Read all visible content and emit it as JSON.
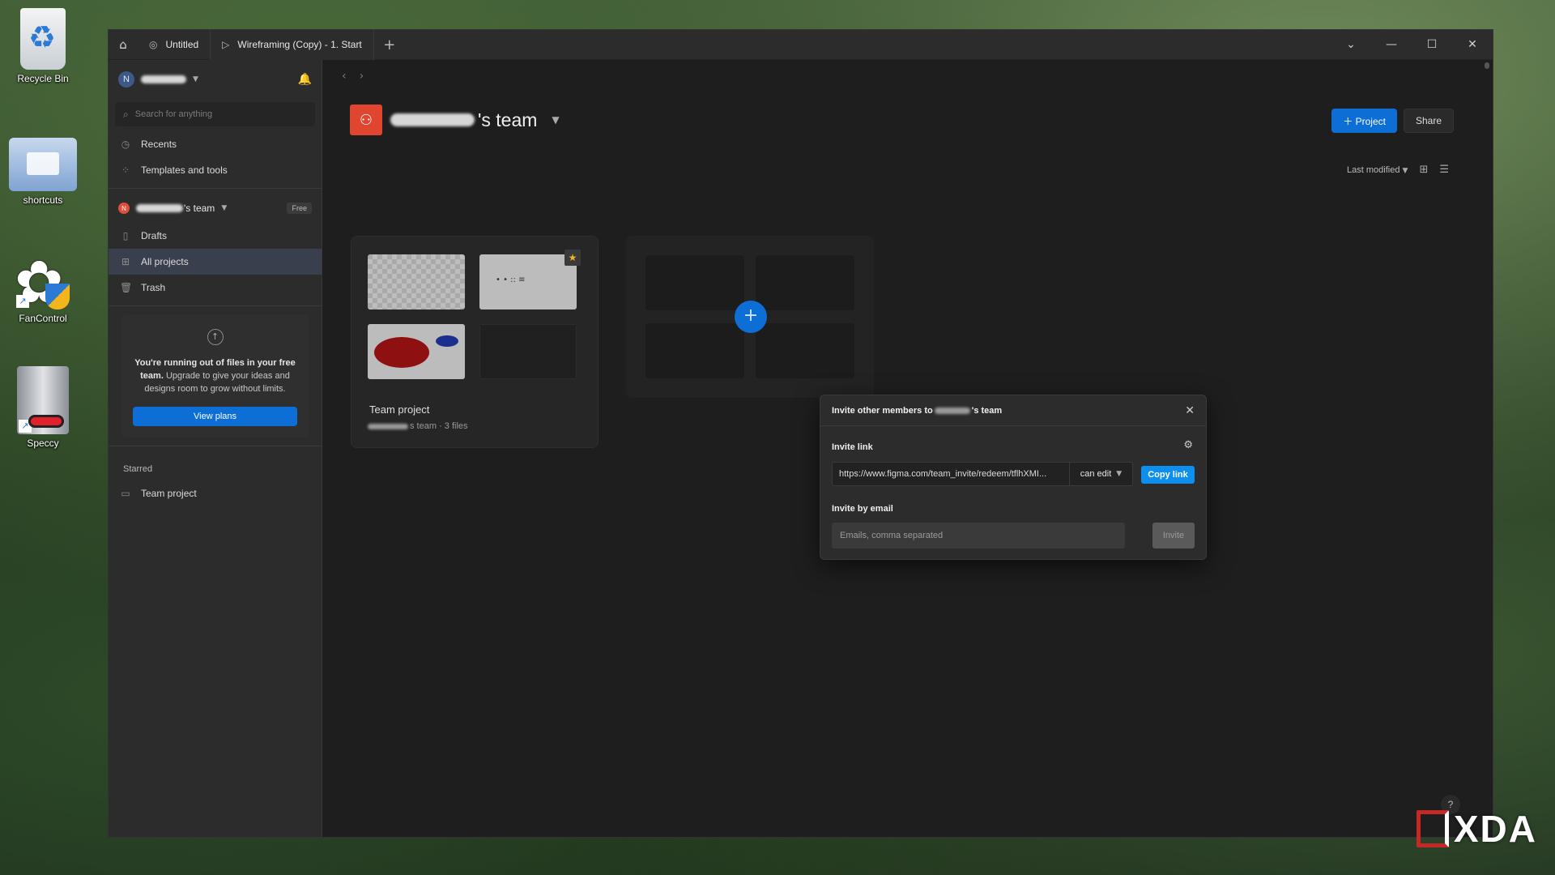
{
  "desktop": {
    "icons": [
      {
        "label": "Recycle Bin"
      },
      {
        "label": "shortcuts"
      },
      {
        "label": "FanControl"
      },
      {
        "label": "Speccy"
      }
    ]
  },
  "titlebar": {
    "tabs": [
      {
        "label": "Untitled"
      },
      {
        "label": "Wireframing (Copy) - 1. Start"
      }
    ]
  },
  "sidebar": {
    "avatar_initial": "N",
    "search_placeholder": "Search for anything",
    "nav": [
      {
        "label": "Recents"
      },
      {
        "label": "Templates and tools"
      }
    ],
    "team": {
      "initial": "N",
      "name_suffix": "'s team",
      "badge": "Free",
      "items": [
        {
          "label": "Drafts"
        },
        {
          "label": "All projects"
        },
        {
          "label": "Trash"
        }
      ]
    },
    "upgrade": {
      "bold": "You're running out of files in your free team.",
      "text": "Upgrade to give your ideas and designs room to grow without limits.",
      "button": "View plans"
    },
    "starred": {
      "label": "Starred",
      "items": [
        {
          "label": "Team project"
        }
      ]
    }
  },
  "main": {
    "team_title_suffix": "'s team",
    "project_button": "Project",
    "share_button": "Share",
    "sort_label": "Last modified",
    "project_card": {
      "title": "Team project",
      "subtitle": "s team · 3 files"
    }
  },
  "modal": {
    "title_prefix": "Invite other members to",
    "title_suffix": "'s team",
    "invite_link_label": "Invite link",
    "link_value": "https://www.figma.com/team_invite/redeem/tflhXMI...",
    "permission": "can edit",
    "copy_button": "Copy link",
    "invite_email_label": "Invite by email",
    "email_placeholder": "Emails, comma separated",
    "invite_button": "Invite"
  },
  "watermark": {
    "text": "XDA"
  },
  "colors": {
    "accent": "#0d6ed6",
    "team": "#e0452f",
    "sidebar": "#2c2c2c",
    "background": "#1e1e1e"
  }
}
